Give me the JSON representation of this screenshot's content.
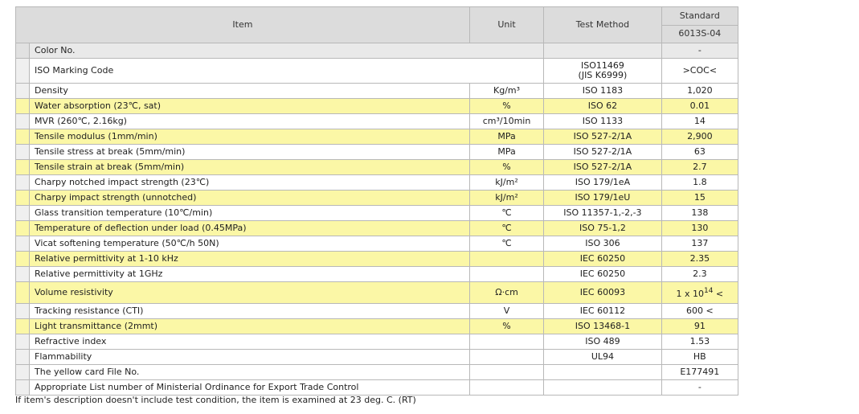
{
  "header": {
    "item": "Item",
    "unit": "Unit",
    "test_method": "Test Method",
    "standard": "Standard",
    "grade": "6013S-04"
  },
  "rows": [
    {
      "item": "Color No.",
      "unit": "",
      "method": "",
      "value": "-",
      "style": "gray",
      "merged": true
    },
    {
      "item": "ISO Marking Code",
      "unit": "",
      "method": "ISO11469\n(JIS K6999)",
      "value": ">COC<",
      "style": "white",
      "merged": true,
      "tall": true
    },
    {
      "item": "Density",
      "unit": "Kg/m³",
      "method": "ISO 1183",
      "value": "1,020",
      "style": "white"
    },
    {
      "item": "Water absorption (23℃, sat)",
      "unit": "%",
      "method": "ISO 62",
      "value": "0.01",
      "style": "yellow"
    },
    {
      "item": "MVR (260℃, 2.16kg)",
      "unit": "cm³/10min",
      "method": "ISO 1133",
      "value": "14",
      "style": "white"
    },
    {
      "item": "Tensile modulus (1mm/min)",
      "unit": "MPa",
      "method": "ISO 527-2/1A",
      "value": "2,900",
      "style": "yellow"
    },
    {
      "item": "Tensile stress at break (5mm/min)",
      "unit": "MPa",
      "method": "ISO 527-2/1A",
      "value": "63",
      "style": "white"
    },
    {
      "item": "Tensile strain at break (5mm/min)",
      "unit": "%",
      "method": "ISO 527-2/1A",
      "value": "2.7",
      "style": "yellow"
    },
    {
      "item": "Charpy notched impact strength (23℃)",
      "unit": "kJ/m²",
      "method": "ISO 179/1eA",
      "value": "1.8",
      "style": "white"
    },
    {
      "item": "Charpy impact strength (unnotched)",
      "unit": "kJ/m²",
      "method": "ISO 179/1eU",
      "value": "15",
      "style": "yellow"
    },
    {
      "item": "Glass transition temperature (10℃/min)",
      "unit": "℃",
      "method": "ISO 11357-1,-2,-3",
      "value": "138",
      "style": "white"
    },
    {
      "item": "Temperature of deflection under load (0.45MPa)",
      "unit": "℃",
      "method": "ISO 75-1,2",
      "value": "130",
      "style": "yellow"
    },
    {
      "item": "Vicat softening temperature (50℃/h 50N)",
      "unit": "℃",
      "method": "ISO 306",
      "value": "137",
      "style": "white"
    },
    {
      "item": "Relative permittivity at 1-10 kHz",
      "unit": "",
      "method": "IEC 60250",
      "value": "2.35",
      "style": "yellow"
    },
    {
      "item": "Relative permittivity at 1GHz",
      "unit": "",
      "method": "IEC 60250",
      "value": "2.3",
      "style": "white"
    },
    {
      "item": "Volume resistivity",
      "unit": "Ω·cm",
      "method": "IEC 60093",
      "value_base": "1 x 10",
      "value_exp": "14",
      "value_suffix": " <",
      "style": "yellow",
      "vol": true
    },
    {
      "item": "Tracking resistance (CTI)",
      "unit": "V",
      "method": "IEC 60112",
      "value": "600 <",
      "style": "white"
    },
    {
      "item": "Light transmittance (2mmt)",
      "unit": "%",
      "method": "ISO 13468-1",
      "value": "91",
      "style": "yellow"
    },
    {
      "item": "Refractive index",
      "unit": "",
      "method": "ISO 489",
      "value": "1.53",
      "style": "white"
    },
    {
      "item": "Flammability",
      "unit": "",
      "method": "UL94",
      "value": "HB",
      "style": "white"
    },
    {
      "item": "The yellow card File No.",
      "unit": "",
      "method": "",
      "value": "E177491",
      "style": "white"
    },
    {
      "item": "Appropriate List number of Ministerial Ordinance for Export Trade Control",
      "unit": "",
      "method": "",
      "value": "-",
      "style": "white"
    }
  ],
  "footnote": "If item's description doesn't include test condition, the item is examined at 23 deg. C. (RT)"
}
